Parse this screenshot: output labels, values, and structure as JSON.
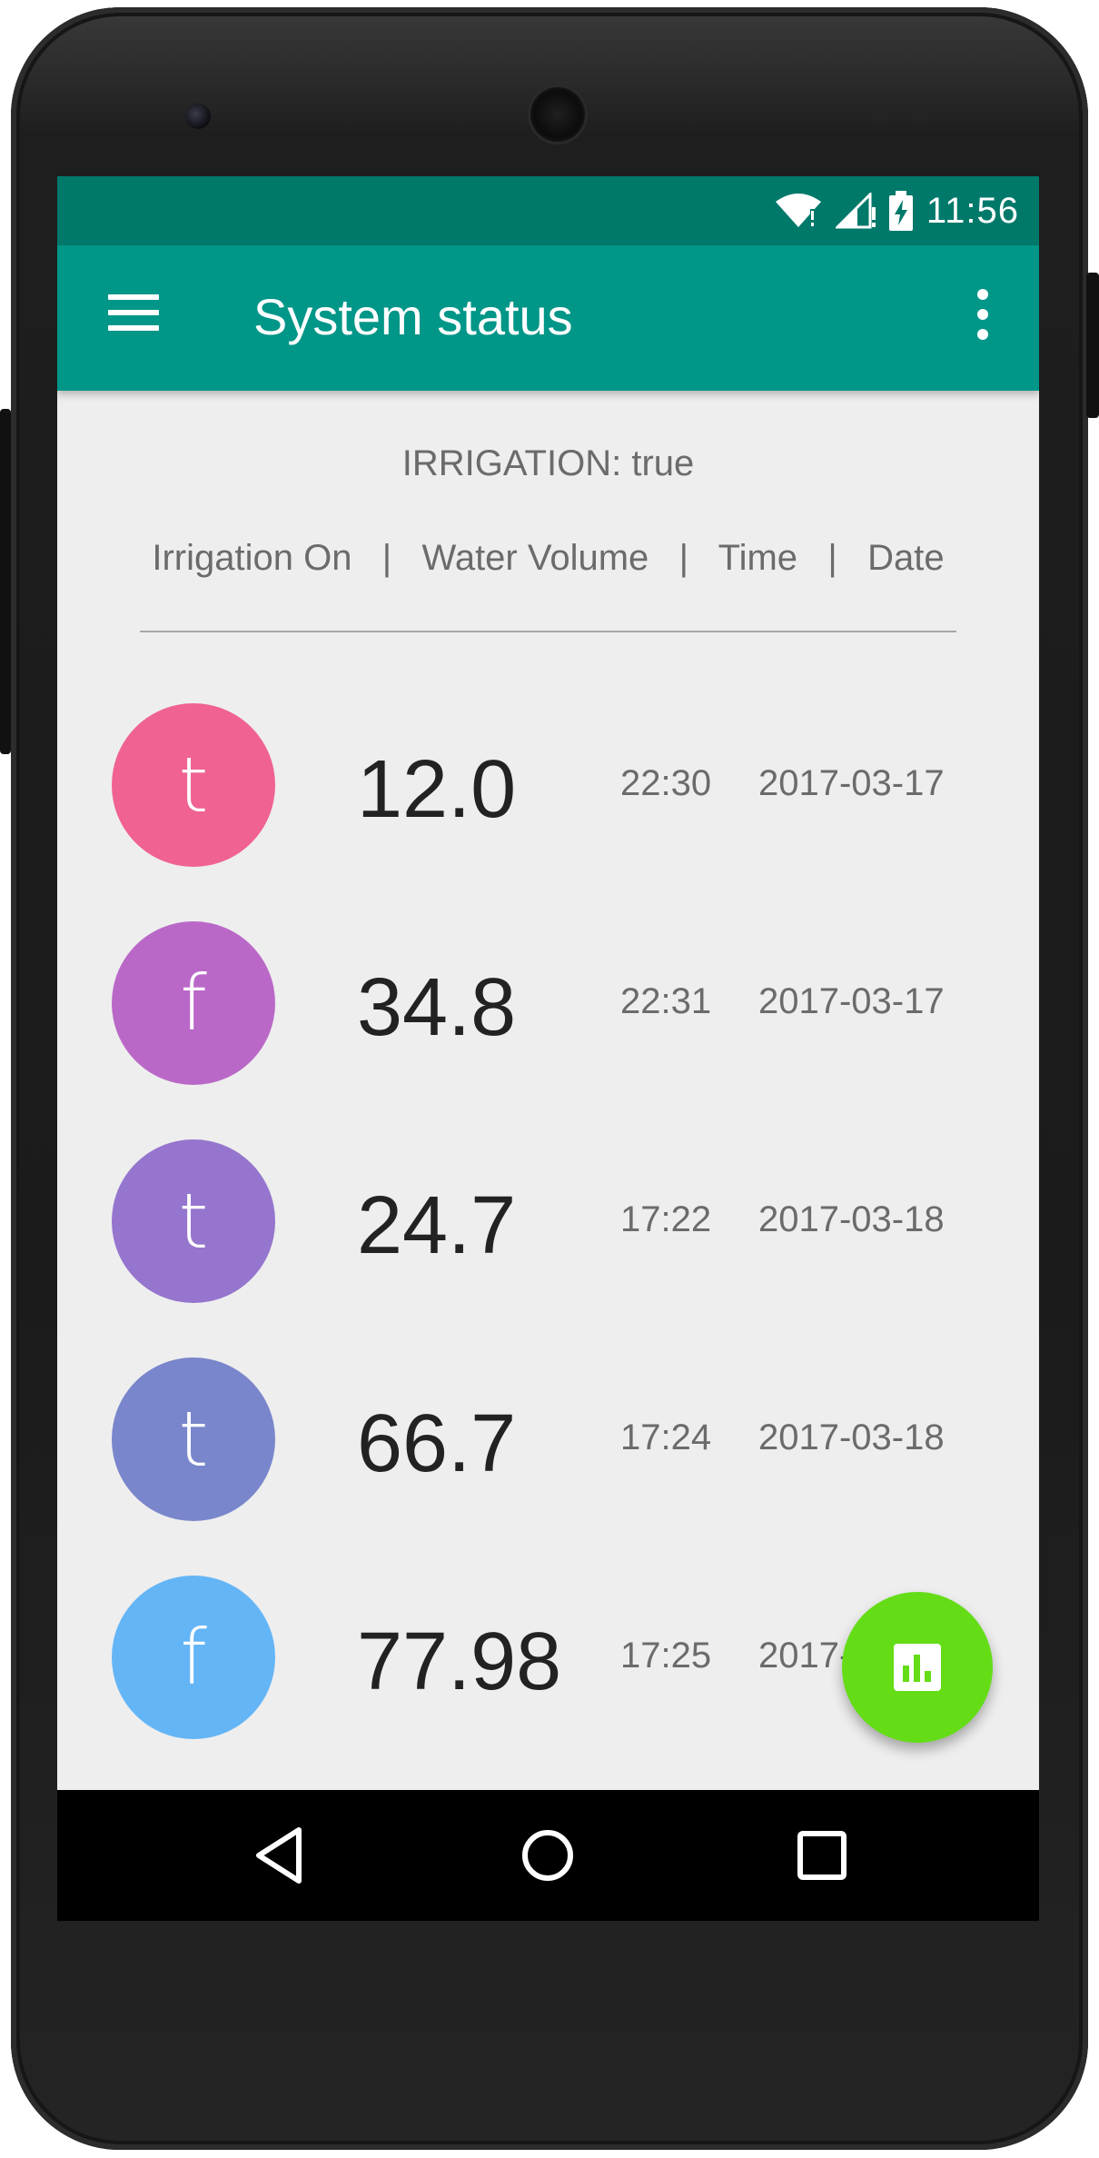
{
  "status_bar": {
    "time": "11:56",
    "icons": [
      "wifi-icon",
      "signal-icon",
      "battery-charging-icon"
    ]
  },
  "app_bar": {
    "title": "System status",
    "menu_icon": "hamburger-menu-icon",
    "overflow_icon": "more-vert-icon"
  },
  "irrigation_status": "IRRIGATION: true",
  "table_headers": [
    "Irrigation On",
    "Water Volume",
    "Time",
    "Date"
  ],
  "rows": [
    {
      "irrigation": "t",
      "volume": "12.0",
      "time": "22:30",
      "date": "2017-03-17",
      "color": "#f06292"
    },
    {
      "irrigation": "f",
      "volume": "34.8",
      "time": "22:31",
      "date": "2017-03-17",
      "color": "#ba68c8"
    },
    {
      "irrigation": "t",
      "volume": "24.7",
      "time": "17:22",
      "date": "2017-03-18",
      "color": "#9575cd"
    },
    {
      "irrigation": "t",
      "volume": "66.7",
      "time": "17:24",
      "date": "2017-03-18",
      "color": "#7986cb"
    },
    {
      "irrigation": "f",
      "volume": "77.98",
      "time": "17:25",
      "date": "2017-03-18",
      "color": "#64b5f6"
    }
  ],
  "fab": {
    "icon": "bar-chart-icon",
    "color": "#64dd17"
  },
  "colors": {
    "status_bar": "#00796b",
    "app_bar": "#009688",
    "background": "#eeeeee"
  },
  "nav_bar": {
    "icons": [
      "back-icon",
      "home-icon",
      "recents-icon"
    ]
  }
}
